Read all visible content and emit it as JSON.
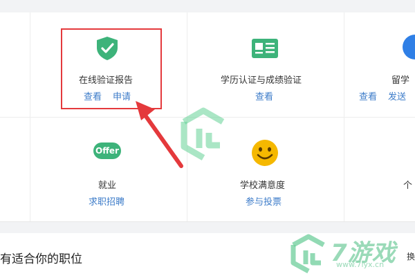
{
  "cells": {
    "online_report": {
      "title": "在线验证报告",
      "link_view": "查看",
      "link_apply": "申请"
    },
    "education_verify": {
      "title": "学历认证与成绩验证",
      "link_view": "查看"
    },
    "study_abroad": {
      "title": "留学",
      "link_view": "查看",
      "link_send": "发送"
    },
    "employment": {
      "title": "就业",
      "link": "求职招聘",
      "badge": "Offer"
    },
    "school_satisfaction": {
      "title": "学校满意度",
      "link": "参与投票"
    },
    "right_partial": {
      "title": "个"
    }
  },
  "bottom": {
    "text": "有适合你的职位",
    "right_text": "换"
  },
  "watermark": {
    "brand": "7游戏",
    "url": "www.7lyx.cn"
  },
  "colors": {
    "link": "#3d7cc9",
    "highlight": "#e4393c",
    "shield": "#3db37a",
    "smiley": "#f5b800",
    "study_abroad": "#2f7fe6"
  }
}
